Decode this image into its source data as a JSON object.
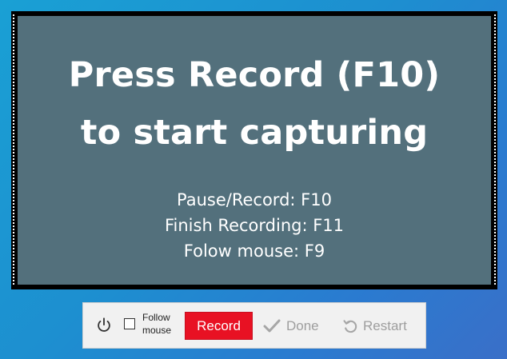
{
  "capture": {
    "headline_line1": "Press Record (F10)",
    "headline_line2": "to start capturing",
    "shortcuts": [
      "Pause/Record: F10",
      "Finish Recording: F11",
      "Folow mouse: F9"
    ]
  },
  "toolbar": {
    "power_icon": "power-icon",
    "follow_mouse_label": "Follow mouse",
    "follow_mouse_checked": false,
    "record_label": "Record",
    "done_label": "Done",
    "done_icon": "checkmark-icon",
    "restart_label": "Restart",
    "restart_icon": "restart-icon"
  },
  "colors": {
    "record_button": "#e81123",
    "capture_overlay": "#53707c",
    "disabled_text": "#9e9e9e"
  }
}
